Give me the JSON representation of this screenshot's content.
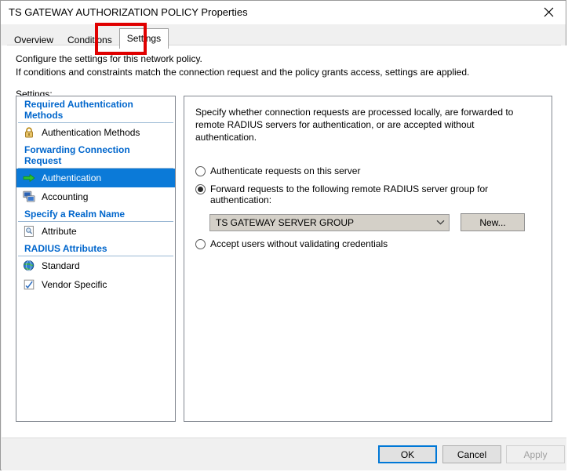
{
  "window": {
    "title": "TS GATEWAY AUTHORIZATION POLICY Properties",
    "close_icon": "close-icon"
  },
  "tabs": [
    {
      "label": "Overview",
      "active": false
    },
    {
      "label": "Conditions",
      "active": false
    },
    {
      "label": "Settings",
      "active": true
    }
  ],
  "annotation": {
    "target": "Settings",
    "color": "#e00000"
  },
  "description": {
    "line1": "Configure the settings for this network policy.",
    "line2": "If conditions and constraints match the connection request and the policy grants access, settings are applied."
  },
  "settings_label": "Settings:",
  "tree": [
    {
      "type": "group",
      "label": "Required Authentication Methods"
    },
    {
      "type": "item",
      "label": "Authentication Methods",
      "icon": "padlock-icon",
      "selected": false
    },
    {
      "type": "group",
      "label": "Forwarding Connection Request"
    },
    {
      "type": "item",
      "label": "Authentication",
      "icon": "green-arrow-icon",
      "selected": true
    },
    {
      "type": "item",
      "label": "Accounting",
      "icon": "computer-icon",
      "selected": false
    },
    {
      "type": "group",
      "label": "Specify a Realm Name"
    },
    {
      "type": "item",
      "label": "Attribute",
      "icon": "document-search-icon",
      "selected": false
    },
    {
      "type": "group",
      "label": "RADIUS Attributes"
    },
    {
      "type": "item",
      "label": "Standard",
      "icon": "globe-icon",
      "selected": false
    },
    {
      "type": "item",
      "label": "Vendor Specific",
      "icon": "checkbox-pencil-icon",
      "selected": false
    }
  ],
  "detail": {
    "intro": "Specify whether connection requests are processed locally, are forwarded to remote RADIUS servers for authentication, or are accepted without authentication.",
    "radio_local": {
      "label": "Authenticate requests on this server",
      "checked": false
    },
    "radio_forward": {
      "label": "Forward requests to the following remote RADIUS server group for authentication:",
      "checked": true
    },
    "radio_accept": {
      "label": "Accept users without validating credentials",
      "checked": false
    },
    "server_group": {
      "value": "TS GATEWAY SERVER GROUP",
      "arrow_icon": "chevron-down-icon"
    },
    "new_button": "New..."
  },
  "footer": {
    "ok": "OK",
    "cancel": "Cancel",
    "apply": "Apply",
    "apply_enabled": false
  },
  "colors": {
    "group_header": "#0066cc",
    "selection": "#0b7ad8",
    "focus_border": "#0078d7",
    "annotation": "#e00000"
  }
}
